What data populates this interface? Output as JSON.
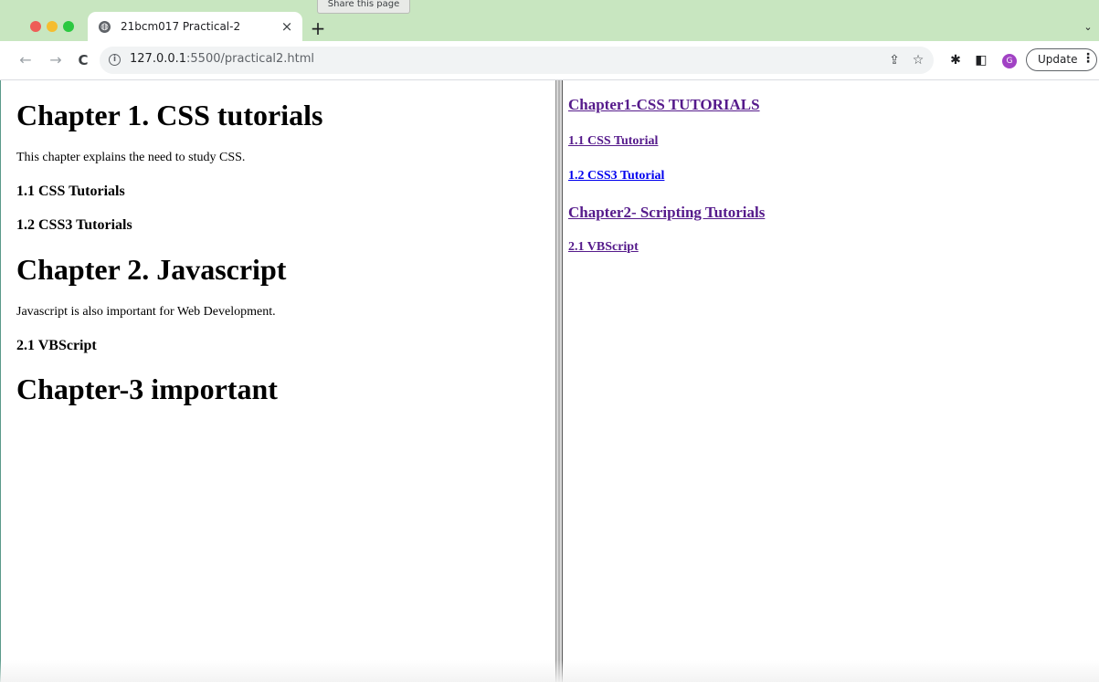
{
  "browser": {
    "tab": {
      "title": "21bcm017 Practical-2",
      "close_glyph": "×"
    },
    "new_tab_glyph": "+",
    "tooltip": "Share this page",
    "tabs_menu_glyph": "⌄",
    "toolbar": {
      "back_glyph": "←",
      "forward_glyph": "→",
      "reload_glyph": "C",
      "url_host": "127.0.0.1",
      "url_path": ":5500/practical2.html",
      "share_glyph": "⇪",
      "star_glyph": "☆",
      "extensions_glyph": "✱",
      "panel_glyph": "◧",
      "avatar_letter": "G",
      "update_label": "Update",
      "menu_glyph": "⋮"
    },
    "icons": {
      "favicon": "globe-icon",
      "info": "info-icon",
      "share": "share-icon",
      "star": "star-icon",
      "extensions": "puzzle-icon",
      "side_panel": "side-panel-icon"
    },
    "colors": {
      "tab_strip": "#c8e6c0",
      "avatar": "#a142c4",
      "visited_link": "#551a8b",
      "unvisited_link": "#0000ee"
    }
  },
  "left_frame": {
    "chapter1_heading": "Chapter 1. CSS tutorials",
    "chapter1_text": "This chapter explains the need to study CSS.",
    "section_1_1": "1.1 CSS Tutorials",
    "section_1_2": "1.2 CSS3 Tutorials",
    "chapter2_heading": "Chapter 2. Javascript",
    "chapter2_text": "Javascript is also important for Web Development.",
    "section_2_1": "2.1 VBScript",
    "chapter3_heading": "Chapter-3 important"
  },
  "right_frame": {
    "links": [
      {
        "label": "Chapter1-CSS TUTORIALS",
        "visited": true
      },
      {
        "label": "1.1 CSS Tutorial",
        "visited": true
      },
      {
        "label": "1.2 CSS3 Tutorial",
        "visited": false
      },
      {
        "label": "Chapter2- Scripting Tutorials",
        "visited": true
      },
      {
        "label": "2.1 VBScript",
        "visited": true
      }
    ]
  }
}
